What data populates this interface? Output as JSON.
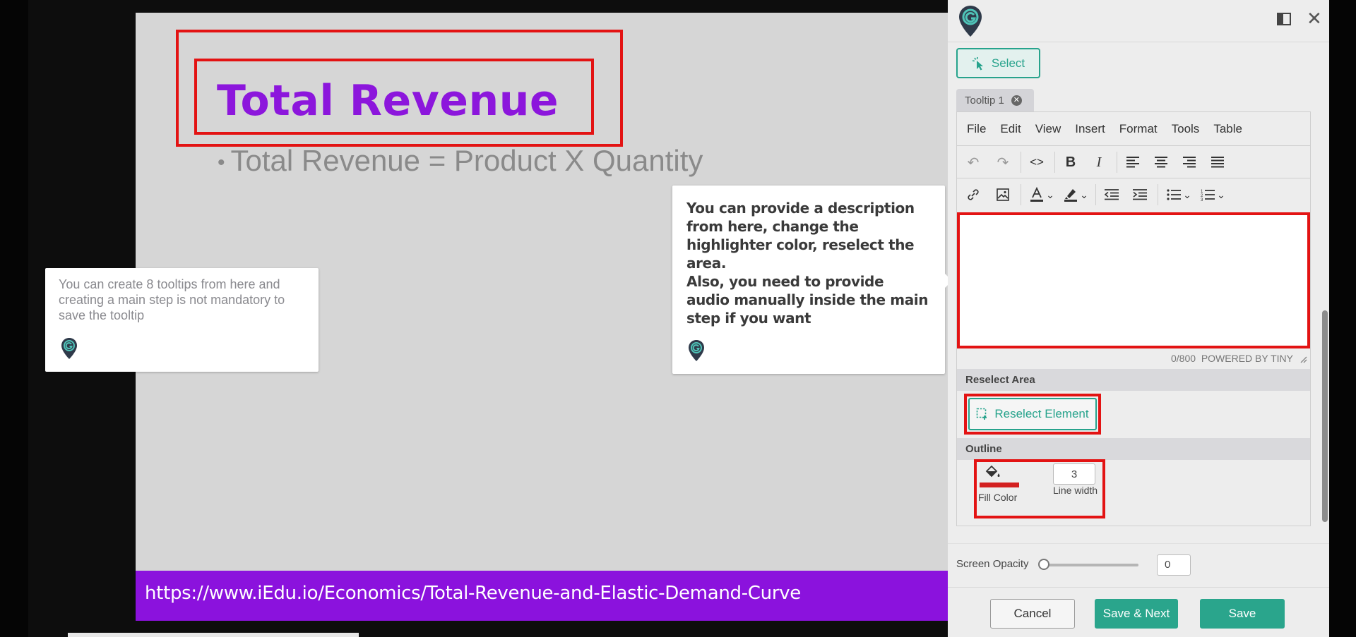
{
  "slide": {
    "title": "Total Revenue",
    "bullet": "Total Revenue = Product X Quantity",
    "url": "https://www.iEdu.io/Economics/Total-Revenue-and-Elastic-Demand-Curve"
  },
  "tooltips": {
    "left_text": "You can create 8 tooltips from here and creating a main step is not mandatory to save the tooltip",
    "right_text_1": "You can provide a description from here, change the highlighter color, reselect the area.",
    "right_text_2": "Also, you need to provide audio manually inside the main step if you want"
  },
  "panel": {
    "select_label": "Select",
    "tab_label": "Tooltip 1",
    "menu": [
      "File",
      "Edit",
      "View",
      "Insert",
      "Format",
      "Tools",
      "Table"
    ],
    "char_count": "0/800",
    "powered_by": "POWERED BY TINY",
    "reselect_area_label": "Reselect Area",
    "reselect_button_label": "Reselect Element",
    "outline_label": "Outline",
    "fill_color_label": "Fill Color",
    "line_width_value": "3",
    "line_width_label": "Line width",
    "screen_opacity_label": "Screen Opacity",
    "screen_opacity_value": "0",
    "cancel_label": "Cancel",
    "save_next_label": "Save & Next",
    "save_label": "Save"
  },
  "colors": {
    "accent": "#2aa58c",
    "highlight": "#e31313",
    "slide_purple": "#8b12dd",
    "fill_color": "#d32020"
  },
  "icons": {
    "logo": "map-pin-g-logo",
    "select": "cursor-click-icon",
    "reselect": "select-area-icon",
    "fill": "paint-bucket-icon"
  }
}
